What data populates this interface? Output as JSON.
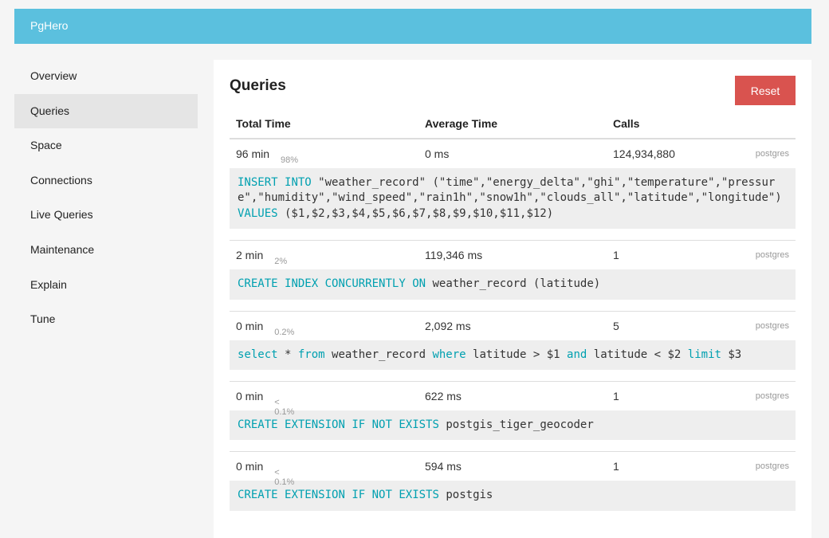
{
  "navbar": {
    "brand": "PgHero"
  },
  "sidebar": {
    "items": [
      {
        "label": "Overview"
      },
      {
        "label": "Queries"
      },
      {
        "label": "Space"
      },
      {
        "label": "Connections"
      },
      {
        "label": "Live Queries"
      },
      {
        "label": "Maintenance"
      },
      {
        "label": "Explain"
      },
      {
        "label": "Tune"
      }
    ],
    "active": "Queries"
  },
  "main": {
    "title": "Queries",
    "reset_label": "Reset",
    "headers": {
      "total_time": "Total Time",
      "average_time": "Average Time",
      "calls": "Calls"
    },
    "queries": [
      {
        "total_time": "96 min",
        "percent": "98%",
        "average_time": "0 ms",
        "calls": "124,934,880",
        "user": "postgres",
        "sql": [
          [
            "kw",
            "INSERT"
          ],
          [
            "t",
            " "
          ],
          [
            "kw",
            "INTO"
          ],
          [
            "t",
            " \"weather_record\" (\"time\",\"energy_delta\",\"ghi\",\"temperature\",\"pressure\",\"humidity\",\"wind_speed\",\"rain1h\",\"snow1h\",\"clouds_all\",\"latitude\",\"longitude\") "
          ],
          [
            "kw",
            "VALUES"
          ],
          [
            "t",
            " ($1,$2,$3,$4,$5,$6,$7,$8,$9,$10,$11,$12)"
          ]
        ]
      },
      {
        "total_time": "2 min",
        "percent": "2%",
        "average_time": "119,346 ms",
        "calls": "1",
        "user": "postgres",
        "sql": [
          [
            "kw",
            "CREATE"
          ],
          [
            "t",
            " "
          ],
          [
            "kw",
            "INDEX"
          ],
          [
            "t",
            " "
          ],
          [
            "kw",
            "CONCURRENTLY"
          ],
          [
            "t",
            " "
          ],
          [
            "kw",
            "ON"
          ],
          [
            "t",
            " weather_record (latitude)"
          ]
        ]
      },
      {
        "total_time": "0 min",
        "percent": "0.2%",
        "average_time": "2,092 ms",
        "calls": "5",
        "user": "postgres",
        "sql": [
          [
            "kw",
            "select"
          ],
          [
            "t",
            " * "
          ],
          [
            "kw",
            "from"
          ],
          [
            "t",
            " weather_record "
          ],
          [
            "kw",
            "where"
          ],
          [
            "t",
            " latitude > $1 "
          ],
          [
            "kw",
            "and"
          ],
          [
            "t",
            " latitude < $2 "
          ],
          [
            "kw",
            "limit"
          ],
          [
            "t",
            " $3"
          ]
        ]
      },
      {
        "total_time": "0 min",
        "percent": "< 0.1%",
        "average_time": "622 ms",
        "calls": "1",
        "user": "postgres",
        "sql": [
          [
            "kw",
            "CREATE"
          ],
          [
            "t",
            " "
          ],
          [
            "kw",
            "EXTENSION"
          ],
          [
            "t",
            " "
          ],
          [
            "kw",
            "IF"
          ],
          [
            "t",
            " "
          ],
          [
            "kw",
            "NOT"
          ],
          [
            "t",
            " "
          ],
          [
            "kw",
            "EXISTS"
          ],
          [
            "t",
            " postgis_tiger_geocoder"
          ]
        ]
      },
      {
        "total_time": "0 min",
        "percent": "< 0.1%",
        "average_time": "594 ms",
        "calls": "1",
        "user": "postgres",
        "sql": [
          [
            "kw",
            "CREATE"
          ],
          [
            "t",
            " "
          ],
          [
            "kw",
            "EXTENSION"
          ],
          [
            "t",
            " "
          ],
          [
            "kw",
            "IF"
          ],
          [
            "t",
            " "
          ],
          [
            "kw",
            "NOT"
          ],
          [
            "t",
            " "
          ],
          [
            "kw",
            "EXISTS"
          ],
          [
            "t",
            " postgis"
          ]
        ]
      }
    ]
  },
  "colors": {
    "navbar": "#5bc0de",
    "reset": "#d9534f",
    "keyword": "#00a0b0",
    "active_nav": "#e5e5e5"
  }
}
